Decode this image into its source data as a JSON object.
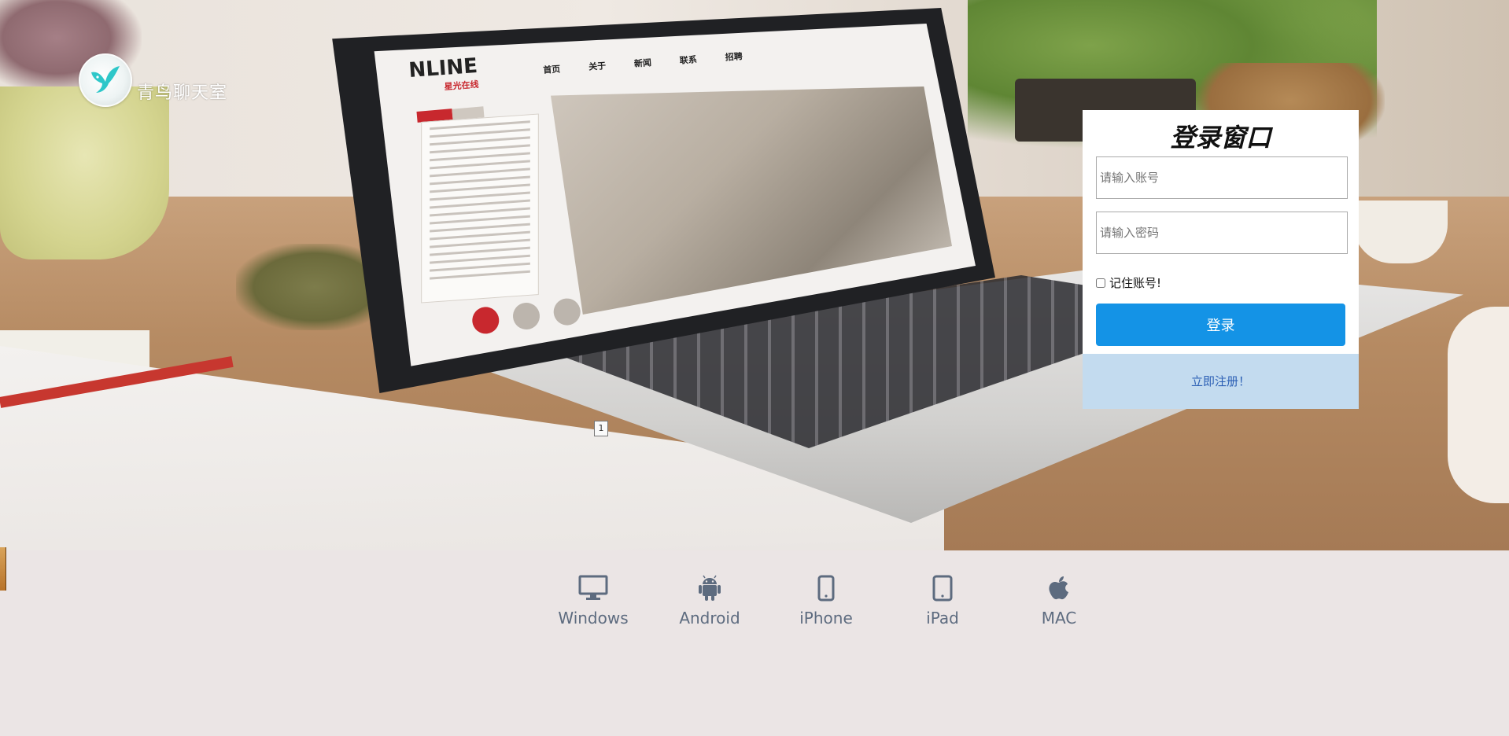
{
  "brand": {
    "title": "青鸟聊天室",
    "logo_icon": "bird-logo-icon",
    "logo_color": "#2ec7c9"
  },
  "login": {
    "title": "登录窗口",
    "account_placeholder": "请输入账号",
    "password_placeholder": "请输入密码",
    "remember_label": "记住账号!",
    "remember_checked": false,
    "submit_label": "登录",
    "register_link": "立即注册！",
    "accent_color": "#1493e6",
    "register_bg": "#c3dbef"
  },
  "background": {
    "laptop_screen_logo": "NLINE",
    "laptop_screen_logo_sub": "星光在线",
    "laptop_screen_nav": [
      "首页",
      "关于",
      "新闻",
      "联系",
      "招聘"
    ],
    "page_marker": "1"
  },
  "platforms": [
    {
      "label": "Windows",
      "icon": "monitor-icon"
    },
    {
      "label": "Android",
      "icon": "android-icon"
    },
    {
      "label": "iPhone",
      "icon": "phone-icon"
    },
    {
      "label": "iPad",
      "icon": "tablet-icon"
    },
    {
      "label": "MAC",
      "icon": "apple-icon"
    }
  ],
  "colors": {
    "page_bg": "#ebe5e5",
    "platform_icon": "#5d6b7f"
  }
}
